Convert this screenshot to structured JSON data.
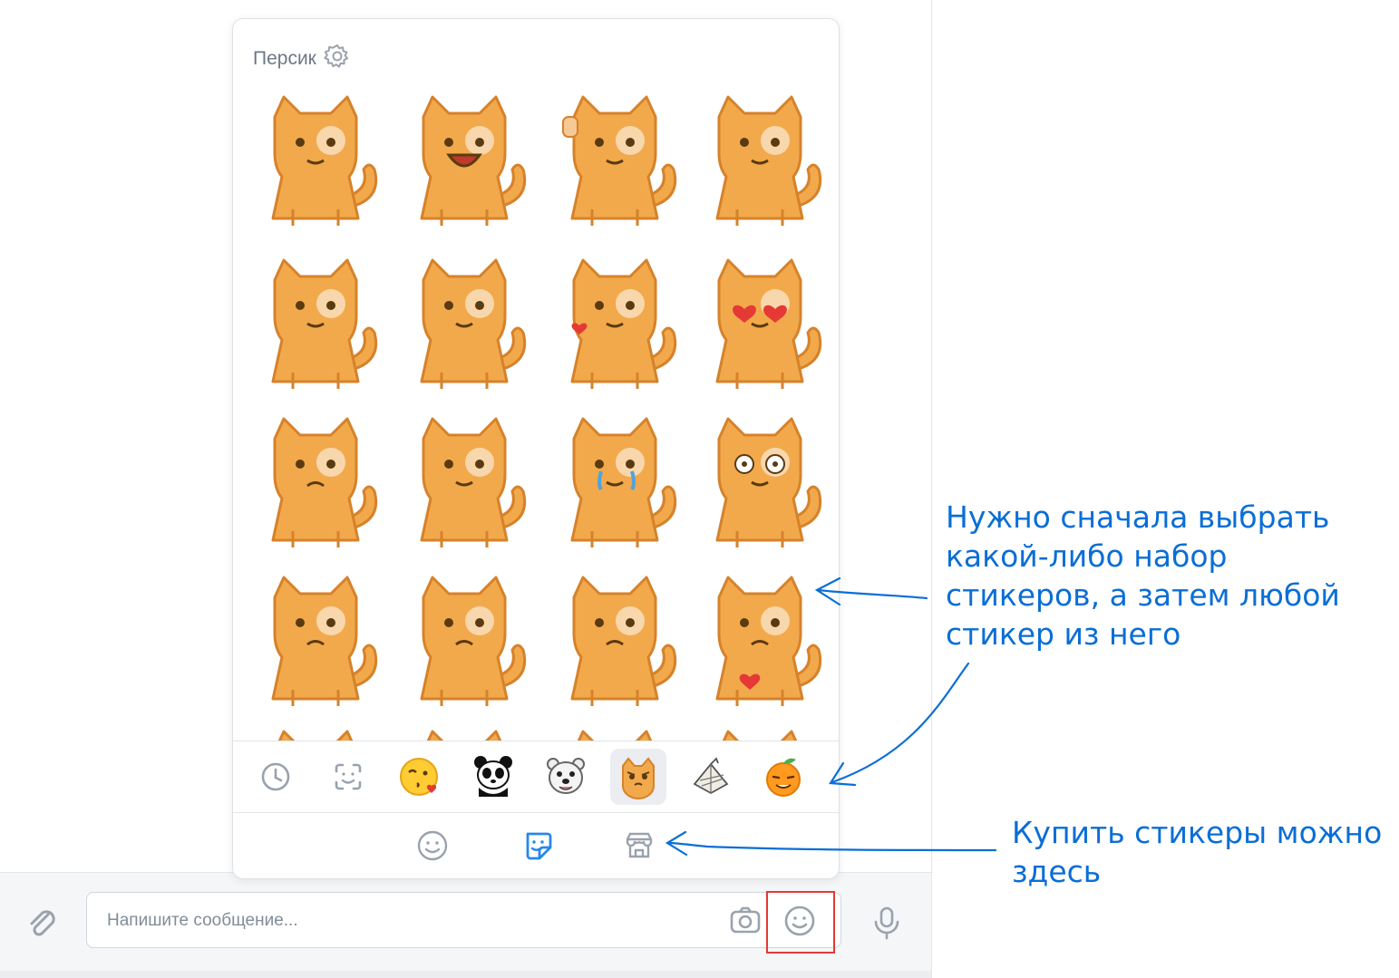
{
  "panel": {
    "pack_title": "Персик",
    "sticker_count_visible": 16,
    "tabs": [
      {
        "icon": "clock-icon"
      },
      {
        "icon": "face-scan-icon"
      },
      {
        "icon": "kissing-emoji-sticker-icon"
      },
      {
        "icon": "panda-sticker-icon"
      },
      {
        "icon": "bear-sticker-icon"
      },
      {
        "icon": "persik-cat-sticker-icon",
        "active": true
      },
      {
        "icon": "paper-bird-sticker-icon"
      },
      {
        "icon": "orange-sticker-icon"
      }
    ],
    "bottom_tabs": [
      {
        "icon": "smile-icon"
      },
      {
        "icon": "sticker-icon",
        "active": true
      },
      {
        "icon": "store-icon"
      }
    ]
  },
  "composer": {
    "placeholder": "Напишите сообщение..."
  },
  "annotations": {
    "note1": [
      "Нужно сначала выбрать",
      "какой-либо набор",
      "стикеров, а затем любой",
      "стикер из него"
    ],
    "note2": [
      "Купить стикеры можно",
      "здесь"
    ]
  },
  "colors": {
    "accent": "#0a6ed6",
    "cat": "#f2a94c",
    "cat_outline": "#d6822a",
    "highlight": "#e53935"
  }
}
